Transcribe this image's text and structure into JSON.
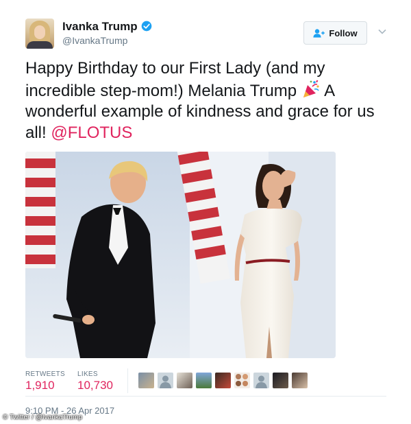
{
  "author": {
    "display_name": "Ivanka Trump",
    "handle": "@IvankaTrump",
    "verified": true
  },
  "follow_button": {
    "label": "Follow",
    "icon": "add-user-icon"
  },
  "tweet": {
    "text": "Happy Birthday to our First Lady (and my incredible step-mom!) Melania Trump",
    "emoji": "party-popper-icon",
    "text_after": "A wonderful example of kindness and grace for us all!",
    "mention": "@FLOTUS"
  },
  "stats": {
    "retweets_label": "RETWEETS",
    "retweets_value": "1,910",
    "likes_label": "LIKES",
    "likes_value": "10,730",
    "liker_avatar_count": 9
  },
  "timestamp": "9:10 PM - 26 Apr 2017",
  "credit": "© Twitter / @IvankaTrump",
  "colors": {
    "accent": "#e0245e",
    "muted": "#657786",
    "verified": "#1da1f2",
    "follow_bg": "#f5f8fa"
  }
}
